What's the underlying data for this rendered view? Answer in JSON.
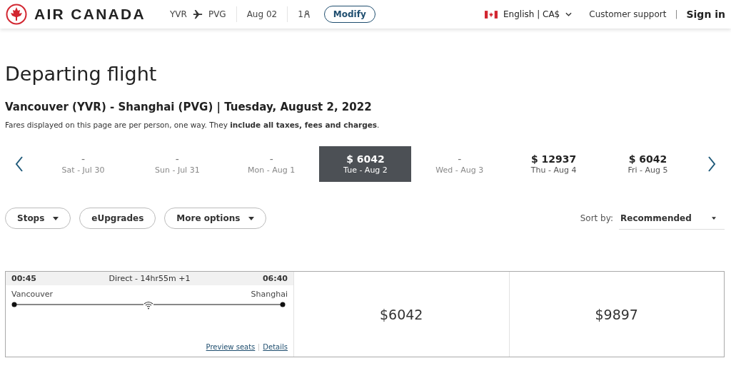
{
  "header": {
    "brand": "AIR CANADA",
    "origin": "YVR",
    "destination": "PVG",
    "date": "Aug 02",
    "passengers": "1",
    "modify": "Modify",
    "language": "English | CA$",
    "support": "Customer support",
    "separator": "|",
    "sign_in": "Sign in"
  },
  "title": "Departing flight",
  "route": "Vancouver (YVR) - Shanghai (PVG) | Tuesday, August 2, 2022",
  "fare_note": "Fares displayed on this page are per person, one way. They **include all taxes, fees and charges**.",
  "dates": [
    {
      "price": "-",
      "label": "Sat - Jul 30",
      "selected": false
    },
    {
      "price": "-",
      "label": "Sun - Jul 31",
      "selected": false
    },
    {
      "price": "-",
      "label": "Mon - Aug 1",
      "selected": false
    },
    {
      "price": "$ 6042",
      "label": "Tue - Aug 2",
      "selected": true
    },
    {
      "price": "-",
      "label": "Wed - Aug 3",
      "selected": false
    },
    {
      "price": "$ 12937",
      "label": "Thu - Aug 4",
      "selected": false
    },
    {
      "price": "$ 6042",
      "label": "Fri - Aug 5",
      "selected": false
    }
  ],
  "filters": [
    {
      "label": "Stops",
      "dropdown": true
    },
    {
      "label": "eUpgrades",
      "dropdown": false
    },
    {
      "label": "More options",
      "dropdown": true
    }
  ],
  "sort": {
    "label": "Sort by:",
    "value": "Recommended"
  },
  "flight": {
    "depart": "00:45",
    "summary": "Direct - 14hr55m +1",
    "arrive": "06:40",
    "from": "Vancouver",
    "to": "Shanghai",
    "preview": "Preview seats",
    "details": "Details",
    "fares": [
      "$6042",
      "$9897"
    ]
  }
}
